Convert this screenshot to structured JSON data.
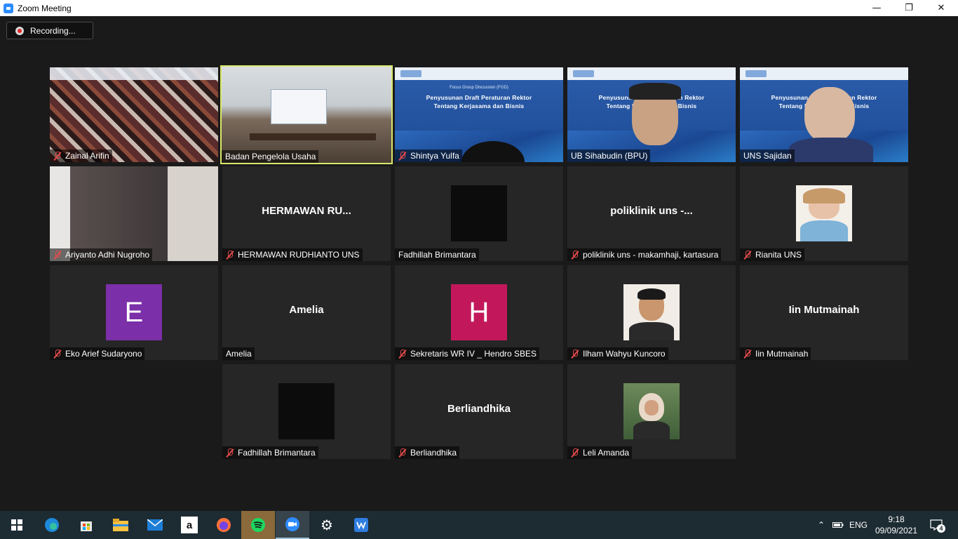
{
  "window": {
    "title": "Zoom Meeting",
    "minimize_glyph": "—",
    "maximize_glyph": "❐",
    "close_glyph": "✕"
  },
  "recording": {
    "label": "Recording..."
  },
  "slide": {
    "line1": "Focus Group Discussion (FGD)",
    "line2": "Penyusunan Draft Peraturan Rektor",
    "line3": "Tentang Kerjasama dan Bisnis"
  },
  "participants": [
    {
      "name": "Zainal Arifin",
      "muted": true
    },
    {
      "name": "Badan Pengelola Usaha",
      "muted": false
    },
    {
      "name": "Shintya Yulfa",
      "muted": true
    },
    {
      "name": "UB Sihabudin (BPU)",
      "muted": false
    },
    {
      "name": "UNS Sajidan",
      "muted": false
    },
    {
      "name": "Ariyanto Adhi Nugroho",
      "muted": true
    },
    {
      "name": "HERMAWAN RUDHIANTO UNS",
      "center": "HERMAWAN  RU...",
      "muted": true
    },
    {
      "name": "Fadhillah Brimantara",
      "muted": false
    },
    {
      "name": "poliklinik uns - makamhaji, kartasura",
      "center": "poliklinik  uns  -...",
      "muted": true
    },
    {
      "name": "Rianita UNS",
      "muted": true
    },
    {
      "name": "Eko Arief Sudaryono",
      "avatar": "E",
      "avatar_color": "#7b2fa8",
      "muted": true
    },
    {
      "name": "Amelia",
      "center": "Amelia",
      "muted": false
    },
    {
      "name": "Sekretaris WR IV _ Hendro SBES",
      "avatar": "H",
      "avatar_color": "#c2185b",
      "muted": true
    },
    {
      "name": "Ilham Wahyu Kuncoro",
      "muted": true
    },
    {
      "name": "Iin Mutmainah",
      "center": "Iin Mutmainah",
      "muted": true
    },
    {
      "name": "Fadhillah Brimantara",
      "muted": true
    },
    {
      "name": "Berliandhika",
      "center": "Berliandhika",
      "muted": true
    },
    {
      "name": "Leli Amanda",
      "muted": true
    }
  ],
  "taskbar": {
    "apps": [
      "start-icon",
      "edge-icon",
      "store-icon",
      "file-explorer-icon",
      "mail-icon",
      "amazon-icon",
      "firefox-icon",
      "spotify-icon",
      "zoom-icon",
      "settings-icon",
      "wps-icon"
    ],
    "language": "ENG",
    "time": "9:18",
    "date": "09/09/2021",
    "notifications": "4"
  },
  "colors": {
    "active_speaker_border": "#d8e86a",
    "mute_red": "#e84b4b",
    "taskbar": "#1d2b33"
  }
}
